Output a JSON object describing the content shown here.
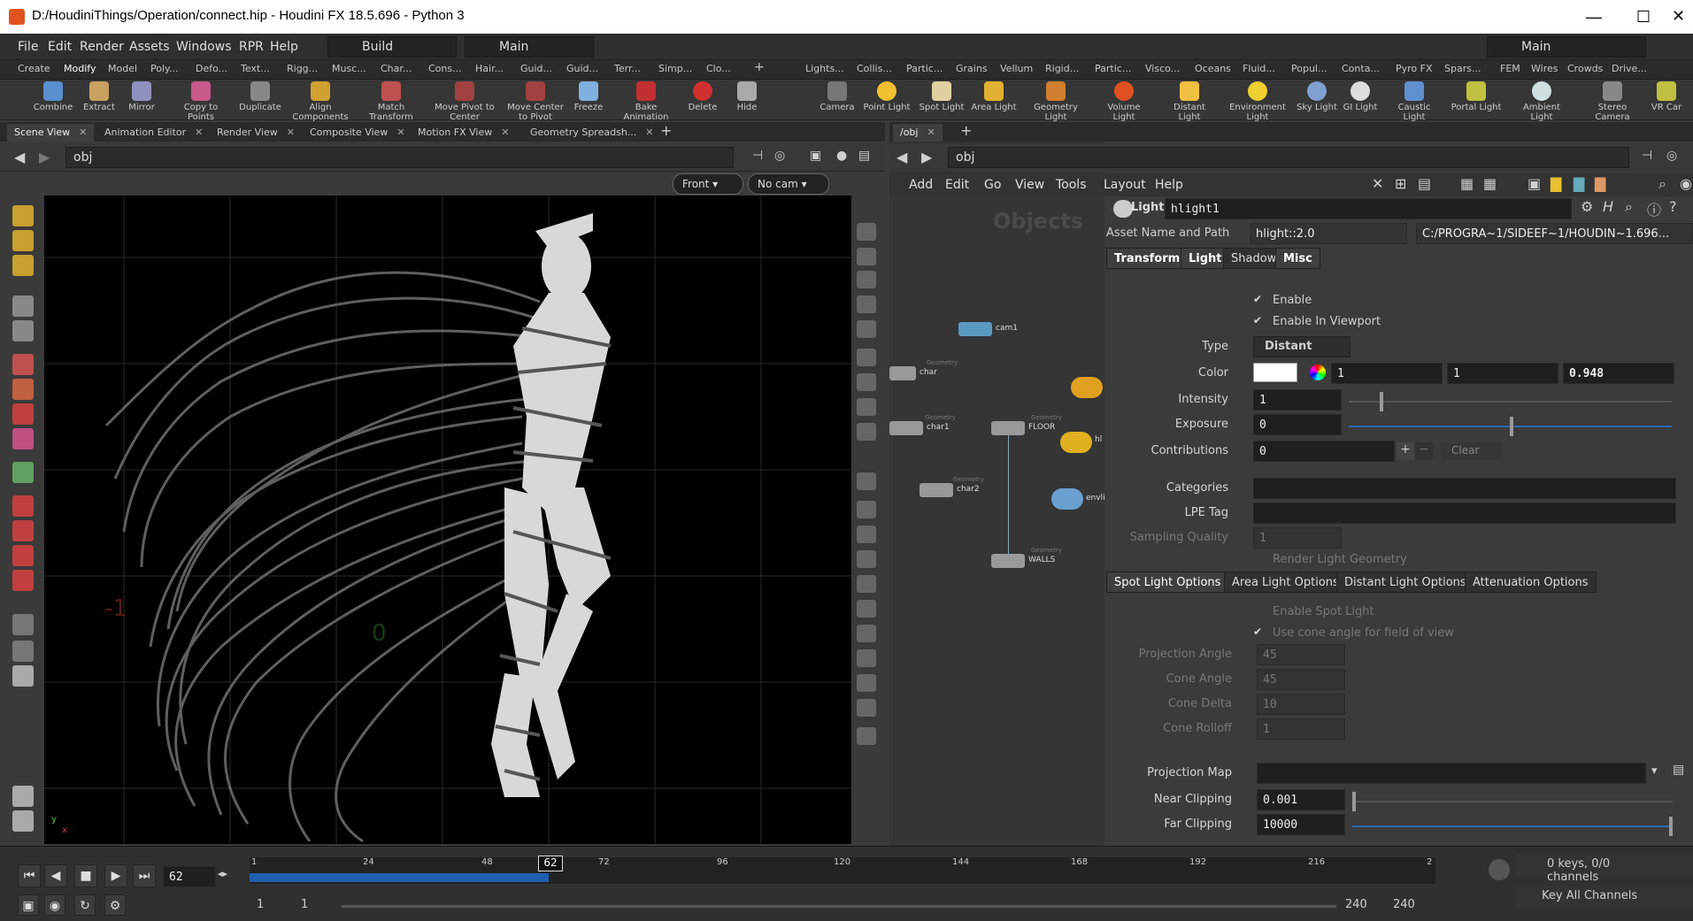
{
  "window": {
    "title": "D:/HoudiniThings/Operation/connect.hip - Houdini FX 18.5.696 - Python 3",
    "min": "—",
    "max": "☐",
    "close": "✕"
  },
  "menubar": {
    "items": [
      "File",
      "Edit",
      "Render",
      "Assets",
      "Windows",
      "RPR",
      "Help"
    ],
    "desktop": "Build",
    "desktop2": "Main",
    "desktop3": "Main"
  },
  "shelf_left": {
    "tabs": [
      "Create",
      "Modify",
      "Model",
      "Poly...",
      "Defo...",
      "Text...",
      "Musc...",
      "Rigg...",
      "Char...",
      "Cons...",
      "Hair...",
      "Guid...",
      "Guid...",
      "Terr...",
      "Simp...",
      "Clo..."
    ],
    "tools": [
      "Combine",
      "Extract",
      "Mirror",
      "Copy to Points",
      "Duplicate",
      "Align Components",
      "Match Transform",
      "Move Pivot to Center",
      "Move Center to Pivot",
      "Freeze",
      "Bake Animation",
      "Delete",
      "Hide"
    ]
  },
  "shelf_right": {
    "tabs": [
      "Lights...",
      "Collis...",
      "Partic...",
      "Grains",
      "Vellum",
      "Rigid...",
      "Partic...",
      "Visco...",
      "Oceans",
      "Fluid...",
      "Popul...",
      "Conta...",
      "Pyro FX",
      "Spars...",
      "FEM",
      "Wires",
      "Crowds",
      "Drive..."
    ],
    "tools": [
      "Camera",
      "Point Light",
      "Spot Light",
      "Area Light",
      "Geometry Light",
      "Volume Light",
      "Distant Light",
      "Environment Light",
      "Sky Light",
      "GI Light",
      "Caustic Light",
      "Portal Light",
      "Ambient Light",
      "Stereo Camera",
      "VR Car"
    ]
  },
  "left_panel_tabs": [
    "Scene View",
    "Animation Editor",
    "Render View",
    "Composite View",
    "Motion FX View",
    "Geometry Spreadsh..."
  ],
  "right_panel_tabs": [
    "/obj"
  ],
  "viewport": {
    "path": "obj",
    "view": "Front",
    "cam": "No cam",
    "axis_label": "-1",
    "axis_zero": "0",
    "axis_y": "y",
    "axis_x": "x"
  },
  "network": {
    "path": "obj",
    "menu": [
      "Add",
      "Edit",
      "Go",
      "View",
      "Tools",
      "Layout",
      "Help"
    ],
    "watermark": "Objects",
    "nodes": [
      {
        "name": "cam1",
        "type": ""
      },
      {
        "name": "char",
        "type": "Geometry"
      },
      {
        "name": "char1",
        "type": "Geometry"
      },
      {
        "name": "FLOOR",
        "type": "Geometry"
      },
      {
        "name": "char2",
        "type": "Geometry"
      },
      {
        "name": "WALLS",
        "type": "Geometry"
      },
      {
        "name": "hl",
        "type": ""
      },
      {
        "name": "envli",
        "type": ""
      }
    ]
  },
  "parms": {
    "node_type": "Light",
    "node_name": "hlight1",
    "asset_label": "Asset Name and Path",
    "asset_name": "hlight::2.0",
    "asset_path": "C:/PROGRA~1/SIDEEF~1/HOUDIN~1.696...",
    "tabs": [
      "Transform",
      "Light",
      "Shadow",
      "Misc"
    ],
    "enable": "Enable",
    "enable_viewport": "Enable In Viewport",
    "type_label": "Type",
    "type_value": "Distant",
    "color_label": "Color",
    "color_r": "1",
    "color_g": "1",
    "color_b": "0.948",
    "intensity_label": "Intensity",
    "intensity": "1",
    "exposure_label": "Exposure",
    "exposure": "0",
    "contrib_label": "Contributions",
    "contrib": "0",
    "clear": "Clear",
    "categories_label": "Categories",
    "lpe_label": "LPE Tag",
    "sampling_label": "Sampling Quality",
    "sampling": "1",
    "render_geo": "Render Light Geometry",
    "subtabs": [
      "Spot Light Options",
      "Area Light Options",
      "Distant Light Options",
      "Attenuation Options"
    ],
    "enable_spot": "Enable Spot Light",
    "use_cone": "Use cone angle for field of view",
    "proj_angle_label": "Projection Angle",
    "proj_angle": "45",
    "cone_angle_label": "Cone Angle",
    "cone_angle": "45",
    "cone_delta_label": "Cone Delta",
    "cone_delta": "10",
    "cone_rolloff_label": "Cone Rolloff",
    "cone_rolloff": "1",
    "proj_map_label": "Projection Map",
    "near_label": "Near Clipping",
    "near": "0.001",
    "far_label": "Far Clipping",
    "far": "10000"
  },
  "timeline": {
    "frame": "62",
    "marker": "62",
    "ticks": [
      "1",
      "24",
      "48",
      "72",
      "96",
      "120",
      "144",
      "168",
      "192",
      "216",
      "2"
    ],
    "start": "1",
    "start2": "1",
    "end": "240",
    "end2": "240",
    "keys": "0 keys, 0/0 channels",
    "keyall": "Key All Channels"
  }
}
